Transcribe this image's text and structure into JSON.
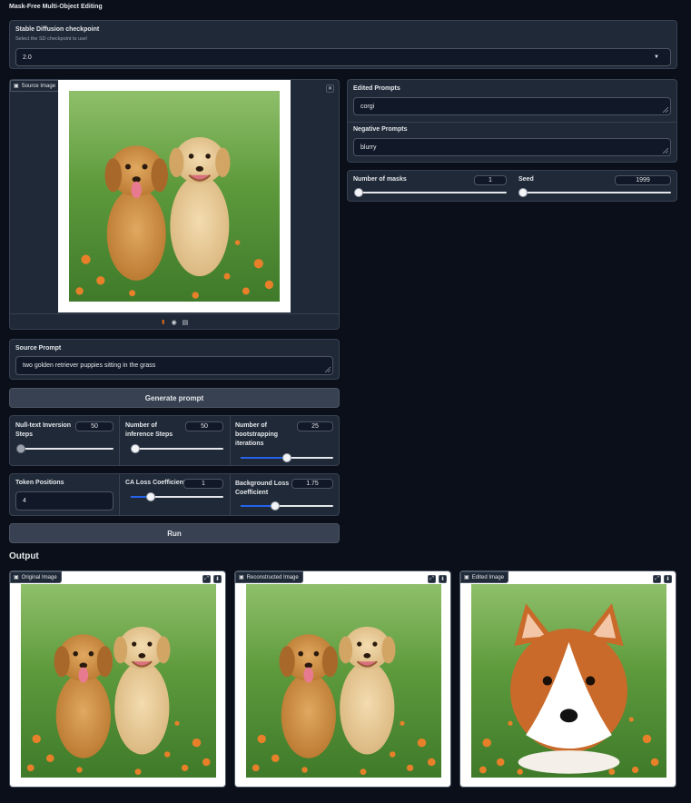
{
  "app": {
    "title": "Mask-Free Multi-Object Editing"
  },
  "checkpoint": {
    "label": "Stable Diffusion checkpoint",
    "info": "Select the SD checkpoint to use!",
    "value": "2.0"
  },
  "source_image": {
    "label": "Source Image"
  },
  "edited_prompts": {
    "label": "Edited Prompts",
    "value": "corgi"
  },
  "negative_prompts": {
    "label": "Negative Prompts",
    "value": "blurry"
  },
  "num_masks": {
    "label": "Number of masks",
    "value": "1",
    "fraction": 0.0
  },
  "seed": {
    "label": "Seed",
    "value": "1999",
    "fraction": 0.0
  },
  "source_prompt": {
    "label": "Source Prompt",
    "value": "two golden retriever puppies sitting in the grass"
  },
  "generate_button": {
    "label": "Generate prompt"
  },
  "null_text": {
    "label": "Null-text Inversion Steps",
    "value": "50",
    "fraction": 0.0
  },
  "inference_steps": {
    "label": "Number of inference Steps",
    "value": "50",
    "fraction": 0.05
  },
  "bootstrapping": {
    "label": "Number of bootstrapping iterations",
    "value": "25",
    "fraction": 0.5
  },
  "token_positions": {
    "label": "Token Positions",
    "value": "4"
  },
  "ca_loss": {
    "label": "CA Loss Coefficient",
    "value": "1",
    "fraction": 0.22
  },
  "bg_loss": {
    "label": "Background Loss Coefficient",
    "value": "1.75",
    "fraction": 0.37
  },
  "run_button": {
    "label": "Run"
  },
  "output": {
    "title": "Output",
    "original": {
      "label": "Original Image"
    },
    "reconstructed": {
      "label": "Reconstructed Image"
    },
    "edited": {
      "label": "Edited Image"
    }
  },
  "colors": {
    "background": "#0b0f19",
    "panel": "#1f2937",
    "accent": "#2563eb",
    "upload_icon": "#f97316"
  },
  "icons": [
    "image-icon",
    "close-icon",
    "upload-icon",
    "webcam-icon",
    "clipboard-icon",
    "dropdown-arrow-icon",
    "fullscreen-icon",
    "download-icon"
  ]
}
